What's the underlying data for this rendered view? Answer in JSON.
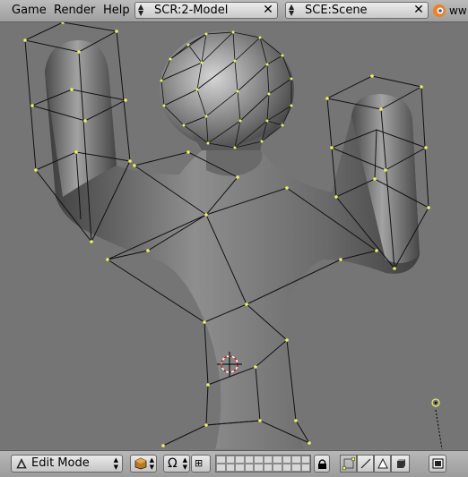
{
  "menu": {
    "game": "Game",
    "render": "Render",
    "help": "Help"
  },
  "screen_selector": {
    "value": "SCR:2-Model"
  },
  "scene_selector": {
    "value": "SCE:Scene"
  },
  "url_fragment": "ww",
  "mode_selector": {
    "value": "Edit Mode"
  },
  "colors": {
    "header_bg": "#a9a9a9",
    "viewport_bg": "#757575",
    "vertex": "#f0f060",
    "wire": "#000000",
    "cursor": "#d02020"
  },
  "icons": [
    "triangle-mode-icon",
    "draw-type-icon",
    "pivot-icon",
    "manipulator-icon",
    "layer-buttons",
    "lock-icon",
    "vertex-select-icon",
    "edge-select-icon",
    "face-select-icon",
    "occlude-icon",
    "render-icon",
    "blender-logo-icon"
  ]
}
